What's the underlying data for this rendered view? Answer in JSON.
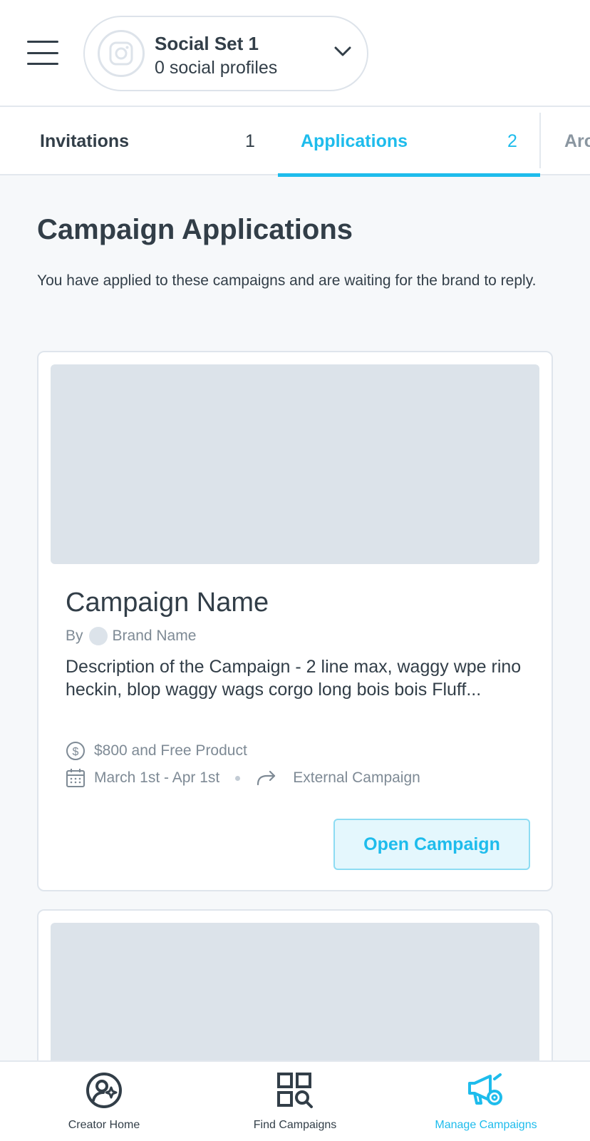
{
  "header": {
    "social_set_name": "Social Set 1",
    "social_set_sub": "0 social profiles"
  },
  "tabs": [
    {
      "label": "Invitations",
      "count": "1",
      "active": false
    },
    {
      "label": "Applications",
      "count": "2",
      "active": true
    },
    {
      "label": "Arc",
      "count": "",
      "active": false
    }
  ],
  "page": {
    "title": "Campaign Applications",
    "description": "You have applied to these campaigns and are waiting for the brand to reply."
  },
  "cards": [
    {
      "campaign_name": "Campaign Name",
      "by_prefix": "By",
      "brand_name": "Brand Name",
      "description": "Description of the Campaign - 2 line max, waggy wpe rino heckin, blop waggy wags corgo long bois bois Fluff...",
      "compensation": "$800 and Free Product",
      "dates": "March 1st - Apr 1st",
      "campaign_type": "External Campaign",
      "button_label": "Open Campaign"
    }
  ],
  "bottom_nav": {
    "items": [
      {
        "label": "Creator Home",
        "icon": "creator-home-icon",
        "active": false
      },
      {
        "label": "Find Campaigns",
        "icon": "find-campaigns-icon",
        "active": false
      },
      {
        "label": "Manage Campaigns",
        "icon": "manage-campaigns-icon",
        "active": true
      }
    ]
  },
  "colors": {
    "accent": "#1ebcec",
    "text": "#323e48",
    "muted": "#7e8a95",
    "placeholder": "#dce3ea",
    "background": "#f6f8fa"
  }
}
